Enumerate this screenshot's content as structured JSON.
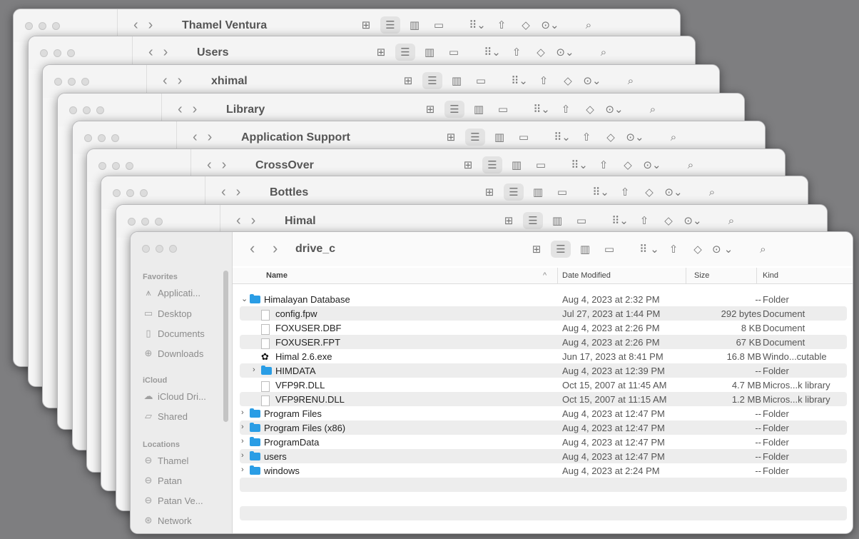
{
  "back_windows": [
    {
      "title": "Thamel Ventura"
    },
    {
      "title": "Users"
    },
    {
      "title": "xhimal"
    },
    {
      "title": "Library"
    },
    {
      "title": "Application Support"
    },
    {
      "title": "CrossOver"
    },
    {
      "title": "Bottles"
    },
    {
      "title": "Himal"
    }
  ],
  "toolbar": {
    "back": "‹",
    "forward": "›",
    "title": "drive_c",
    "icon_view": "⊞",
    "list_view": "☰",
    "column_view": "▥",
    "gallery_view": "▭",
    "group": "⠿ ⌄",
    "share": "⇧",
    "tag": "◇",
    "more": "⊙ ⌄",
    "search": "⌕"
  },
  "sidebar": {
    "favorites_header": "Favorites",
    "favorites": [
      {
        "label": "Applicati...",
        "icon": "applications-icon"
      },
      {
        "label": "Desktop",
        "icon": "desktop-icon"
      },
      {
        "label": "Documents",
        "icon": "documents-icon"
      },
      {
        "label": "Downloads",
        "icon": "downloads-icon"
      }
    ],
    "icloud_header": "iCloud",
    "icloud": [
      {
        "label": "iCloud Dri...",
        "icon": "icloud-icon"
      },
      {
        "label": "Shared",
        "icon": "shared-folder-icon"
      }
    ],
    "locations_header": "Locations",
    "locations": [
      {
        "label": "Thamel",
        "icon": "drive-icon"
      },
      {
        "label": "Patan",
        "icon": "drive-icon"
      },
      {
        "label": "Patan Ve...",
        "icon": "drive-icon"
      },
      {
        "label": "Network",
        "icon": "network-icon"
      }
    ]
  },
  "columns": {
    "name": "Name",
    "date": "Date Modified",
    "size": "Size",
    "kind": "Kind",
    "sort_indicator": "^"
  },
  "files": [
    {
      "name": "Himalayan Database",
      "date": "Aug 4, 2023 at 2:32 PM",
      "size": "--",
      "kind": "Folder",
      "type": "folder",
      "indent": 0,
      "disclosure": "⌄"
    },
    {
      "name": "config.fpw",
      "date": "Jul 27, 2023 at 1:44 PM",
      "size": "292 bytes",
      "kind": "Document",
      "type": "doc",
      "indent": 1,
      "disclosure": ""
    },
    {
      "name": "FOXUSER.DBF",
      "date": "Aug 4, 2023 at 2:26 PM",
      "size": "8 KB",
      "kind": "Document",
      "type": "doc",
      "indent": 1,
      "disclosure": ""
    },
    {
      "name": "FOXUSER.FPT",
      "date": "Aug 4, 2023 at 2:26 PM",
      "size": "67 KB",
      "kind": "Document",
      "type": "doc",
      "indent": 1,
      "disclosure": ""
    },
    {
      "name": "Himal 2.6.exe",
      "date": "Jun 17, 2023 at 8:41 PM",
      "size": "16.8 MB",
      "kind": "Windo...cutable",
      "type": "exe",
      "indent": 1,
      "disclosure": ""
    },
    {
      "name": "HIMDATA",
      "date": "Aug 4, 2023 at 12:39 PM",
      "size": "--",
      "kind": "Folder",
      "type": "folder",
      "indent": 1,
      "disclosure": "›"
    },
    {
      "name": "VFP9R.DLL",
      "date": "Oct 15, 2007 at 11:45 AM",
      "size": "4.7 MB",
      "kind": "Micros...k library",
      "type": "doc",
      "indent": 1,
      "disclosure": ""
    },
    {
      "name": "VFP9RENU.DLL",
      "date": "Oct 15, 2007 at 11:15 AM",
      "size": "1.2 MB",
      "kind": "Micros...k library",
      "type": "doc",
      "indent": 1,
      "disclosure": ""
    },
    {
      "name": "Program Files",
      "date": "Aug 4, 2023 at 12:47 PM",
      "size": "--",
      "kind": "Folder",
      "type": "folder",
      "indent": 0,
      "disclosure": "›"
    },
    {
      "name": "Program Files (x86)",
      "date": "Aug 4, 2023 at 12:47 PM",
      "size": "--",
      "kind": "Folder",
      "type": "folder",
      "indent": 0,
      "disclosure": "›"
    },
    {
      "name": "ProgramData",
      "date": "Aug 4, 2023 at 12:47 PM",
      "size": "--",
      "kind": "Folder",
      "type": "folder",
      "indent": 0,
      "disclosure": "›"
    },
    {
      "name": "users",
      "date": "Aug 4, 2023 at 12:47 PM",
      "size": "--",
      "kind": "Folder",
      "type": "folder",
      "indent": 0,
      "disclosure": "›"
    },
    {
      "name": "windows",
      "date": "Aug 4, 2023 at 2:24 PM",
      "size": "--",
      "kind": "Folder",
      "type": "folder",
      "indent": 0,
      "disclosure": "›"
    }
  ]
}
